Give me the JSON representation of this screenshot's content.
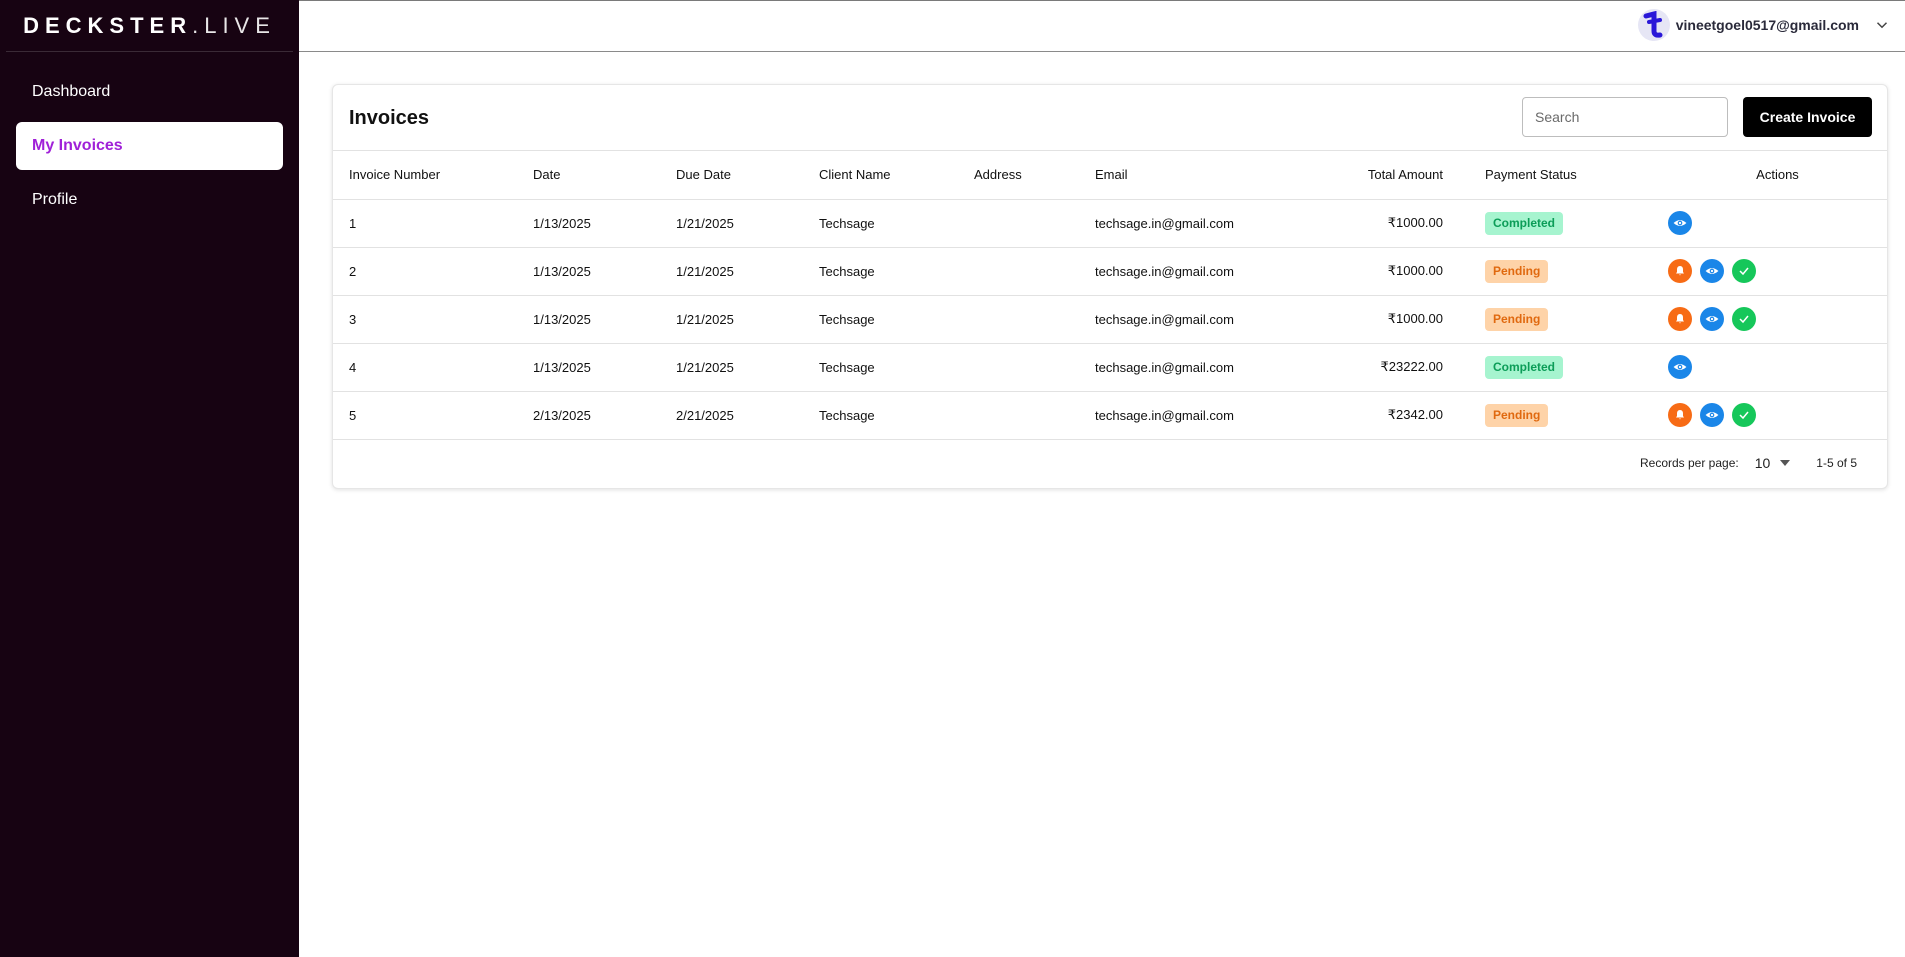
{
  "brand": {
    "bold": "DECKSTER",
    "light": ".LIVE"
  },
  "sidebar": {
    "items": [
      {
        "label": "Dashboard"
      },
      {
        "label": "My Invoices"
      },
      {
        "label": "Profile"
      }
    ]
  },
  "header": {
    "user_email": "vineetgoel0517@gmail.com",
    "menu_icon": "chevron-down-icon"
  },
  "page": {
    "title": "Invoices",
    "search_placeholder": "Search",
    "create_label": "Create Invoice"
  },
  "table": {
    "columns": [
      "Invoice Number",
      "Date",
      "Due Date",
      "Client Name",
      "Address",
      "Email",
      "Total Amount",
      "Payment Status",
      "Actions"
    ],
    "rows": [
      {
        "number": "1",
        "date": "1/13/2025",
        "due": "1/21/2025",
        "client": "Techsage",
        "address": "",
        "email": "techsage.in@gmail.com",
        "amount": "₹1000.00",
        "status": "Completed",
        "actions": [
          "eye"
        ]
      },
      {
        "number": "2",
        "date": "1/13/2025",
        "due": "1/21/2025",
        "client": "Techsage",
        "address": "",
        "email": "techsage.in@gmail.com",
        "amount": "₹1000.00",
        "status": "Pending",
        "actions": [
          "bell",
          "eye",
          "check"
        ]
      },
      {
        "number": "3",
        "date": "1/13/2025",
        "due": "1/21/2025",
        "client": "Techsage",
        "address": "",
        "email": "techsage.in@gmail.com",
        "amount": "₹1000.00",
        "status": "Pending",
        "actions": [
          "bell",
          "eye",
          "check"
        ]
      },
      {
        "number": "4",
        "date": "1/13/2025",
        "due": "1/21/2025",
        "client": "Techsage",
        "address": "",
        "email": "techsage.in@gmail.com",
        "amount": "₹23222.00",
        "status": "Completed",
        "actions": [
          "eye"
        ]
      },
      {
        "number": "5",
        "date": "2/13/2025",
        "due": "2/21/2025",
        "client": "Techsage",
        "address": "",
        "email": "techsage.in@gmail.com",
        "amount": "₹2342.00",
        "status": "Pending",
        "actions": [
          "bell",
          "eye",
          "check"
        ]
      }
    ]
  },
  "pagination": {
    "label": "Records per page:",
    "per_page": "10",
    "range": "1-5 of 5"
  },
  "colors": {
    "sidebar": "#170312",
    "active_nav": "#a020d8",
    "completed_bg": "#a6f4cf",
    "pending_bg": "#fed3a8",
    "bell": "#f76b15",
    "eye": "#1a86e8",
    "check": "#16c75a"
  }
}
